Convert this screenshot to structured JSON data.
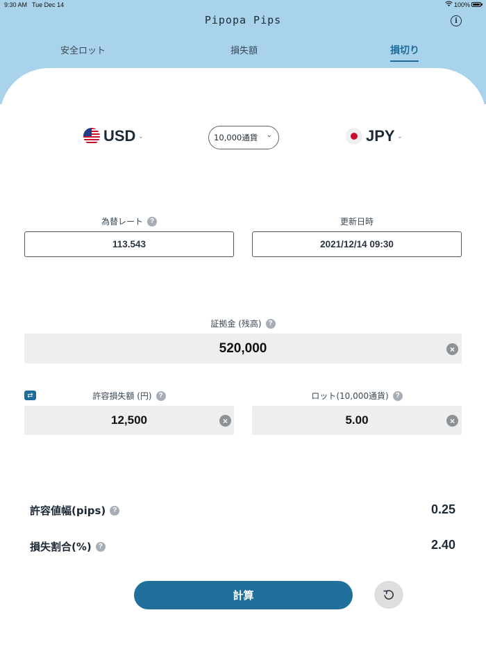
{
  "status_bar": {
    "time": "9:30 AM",
    "date": "Tue Dec 14",
    "battery": "100%"
  },
  "header": {
    "title": "Pipopa Pips",
    "info_icon": "info-icon"
  },
  "tabs": [
    {
      "label": "安全ロット",
      "active": false
    },
    {
      "label": "損失額",
      "active": false
    },
    {
      "label": "損切り",
      "active": true
    }
  ],
  "currency_pair": {
    "base": {
      "code": "USD",
      "flag": "us-flag-icon"
    },
    "quote": {
      "code": "JPY",
      "flag": "jp-flag-icon"
    },
    "unit": "10,000通貨"
  },
  "rate": {
    "label": "為替レート",
    "value": "113.543"
  },
  "updated": {
    "label": "更新日時",
    "value": "2021/12/14 09:30"
  },
  "margin": {
    "label": "証拠金 (残高)",
    "value": "520,000"
  },
  "allowed_loss": {
    "label": "許容損失額 (円)",
    "value": "12,500"
  },
  "lot": {
    "label": "ロット(10,000通貨)",
    "value": "5.00"
  },
  "results": [
    {
      "label": "許容値幅(pips)",
      "value": "0.25"
    },
    {
      "label": "損失割合(%)",
      "value": "2.40"
    }
  ],
  "actions": {
    "calculate": "計算",
    "reset_icon": "reset-icon"
  },
  "colors": {
    "header_bg": "#a9d3ea",
    "accent": "#1f6c9b",
    "field_bg": "#eeeeee"
  }
}
